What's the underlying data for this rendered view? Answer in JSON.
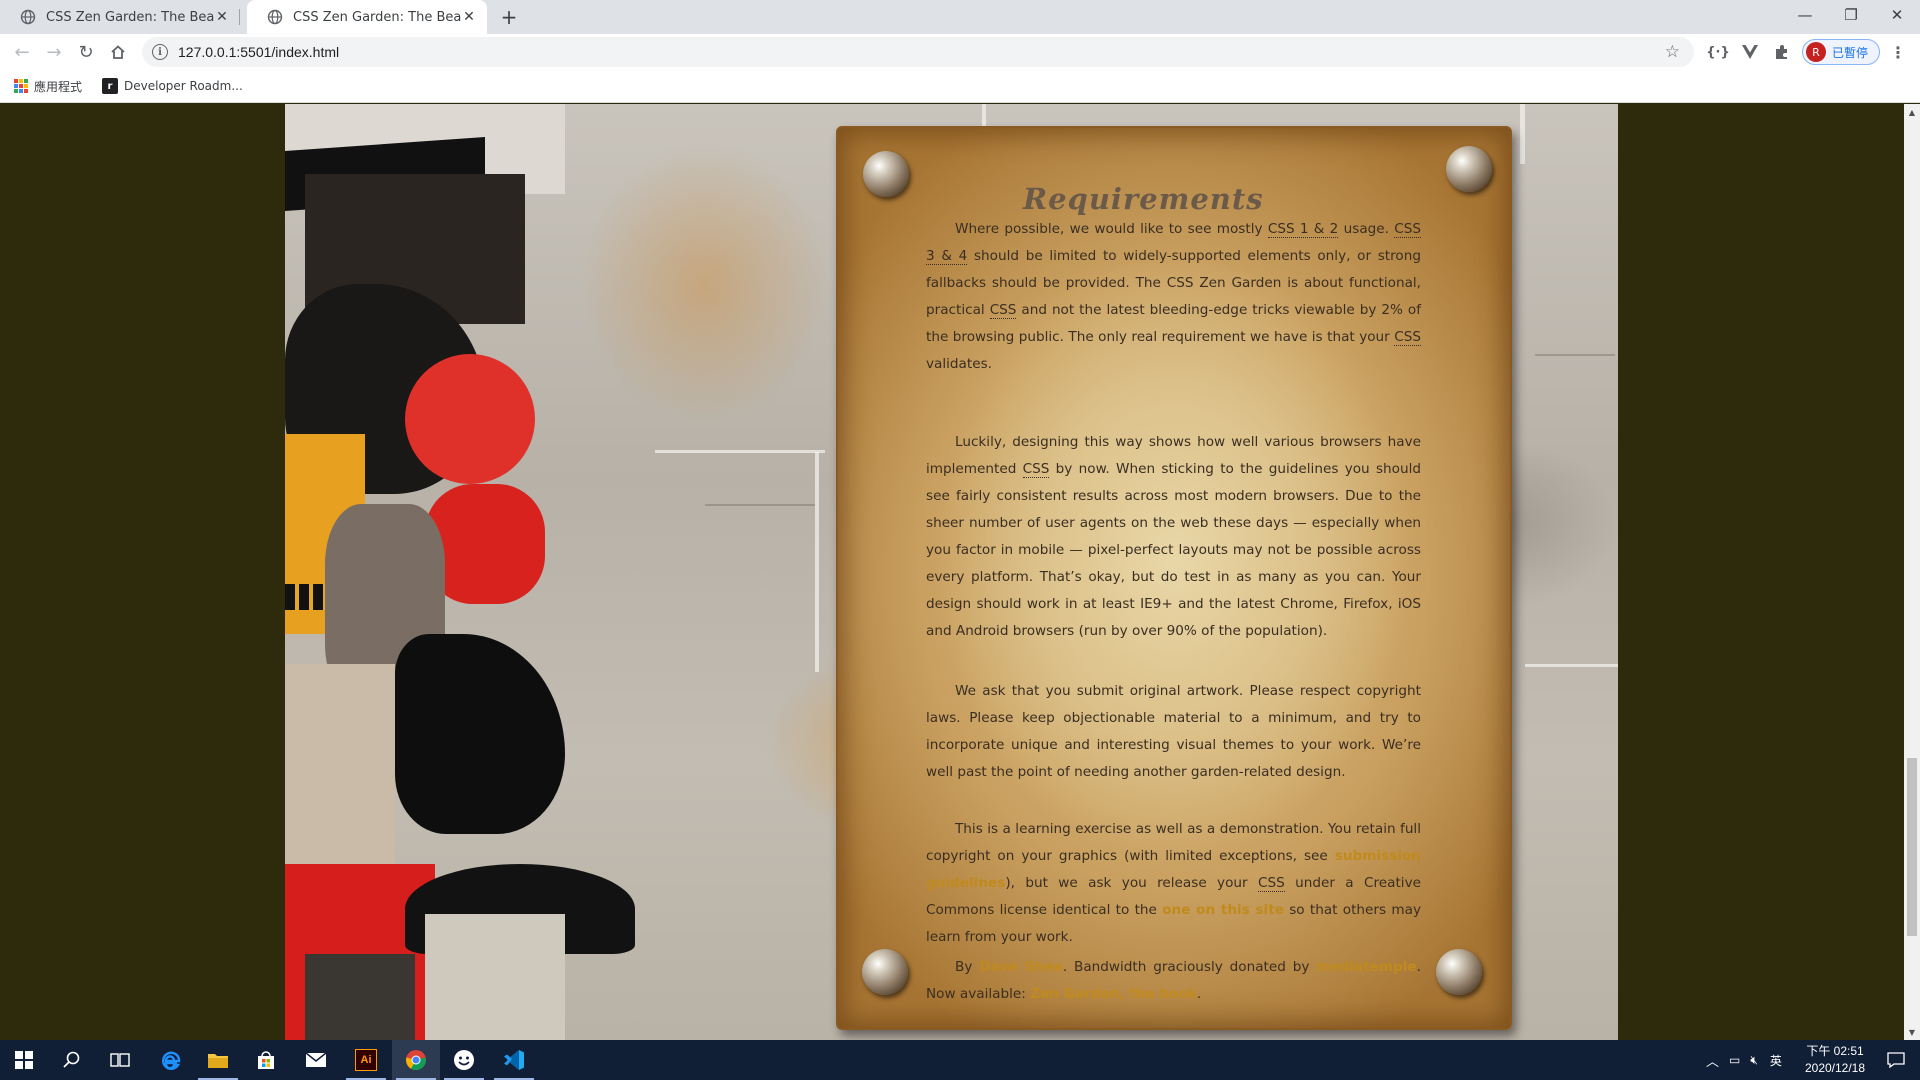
{
  "browser": {
    "tabs": [
      {
        "title": "CSS Zen Garden: The Beauty of CSS Design",
        "active": false
      },
      {
        "title": "CSS Zen Garden: The Beauty of CSS Design",
        "active": true
      }
    ],
    "address": "127.0.0.1:5501/index.html",
    "profile_label": "已暫停",
    "profile_initial": "R",
    "bookmarks": [
      {
        "label": "應用程式",
        "icon": "apps-icon"
      },
      {
        "label": "Developer Roadm...",
        "icon": "roadmap-icon"
      }
    ]
  },
  "page": {
    "heading": "Requirements",
    "p1": {
      "t1": "Where possible, we would like to see mostly ",
      "a1": "CSS 1 & 2",
      "t2": " usage. ",
      "a2": "CSS 3 & 4",
      "t3": " should be limited to widely-supported elements only, or strong fallbacks should be provided. The CSS Zen Garden is about functional, practical ",
      "a3": "CSS",
      "t4": " and not the latest bleeding-edge tricks viewable by 2% of the browsing public. The only real requirement we have is that your ",
      "a4": "CSS",
      "t5": " validates."
    },
    "p2": {
      "t1": "Luckily, designing this way shows how well various browsers have implemented ",
      "a1": "CSS",
      "t2": " by now. When sticking to the guidelines you should see fairly consistent results across most modern browsers. Due to the sheer number of user agents on the web these days — especially when you factor in mobile — pixel-perfect layouts may not be possible across every platform. That’s okay, but do test in as many as you can. Your design should work in at least IE9+ and the latest Chrome, Firefox, iOS and Android browsers (run by over 90% of the population)."
    },
    "p3": "We ask that you submit original artwork. Please respect copyright laws. Please keep objectionable material to a minimum, and try to incorporate unique and interesting visual themes to your work. We’re well past the point of needing another garden-related design.",
    "p4": {
      "t1": "This is a learning exercise as well as a demonstration. You retain full copyright on your graphics (with limited exceptions, see ",
      "link1": "submission guidelines",
      "t2": "), but we ask you release your ",
      "a1": "CSS",
      "t3": " under a Creative Commons license identical to the ",
      "link2": "one on this site",
      "t4": " so that others may learn from your work."
    },
    "p5": {
      "t1": "By ",
      "link1": "Dave Shea",
      "t2": ". Bandwidth graciously donated by ",
      "link2": "mediatemple",
      "t3": ". Now available: ",
      "link3": "Zen Garden, the book",
      "t4": "."
    }
  },
  "taskbar": {
    "time": "下午 02:51",
    "date": "2020/12/18",
    "ime": "英",
    "apps": [
      "start-icon",
      "search-icon",
      "task-view-icon",
      "edge-icon",
      "file-explorer-icon",
      "store-icon",
      "mail-icon",
      "illustrator-icon",
      "chrome-icon",
      "emoji-icon",
      "vscode-icon"
    ],
    "illustrator_label": "Ai"
  },
  "colors": {
    "page_bg": "#2e2a0c",
    "link": "#c08a1d",
    "text": "#3a2e22",
    "heading": "#6b5a49",
    "taskbar": "#101e36"
  }
}
